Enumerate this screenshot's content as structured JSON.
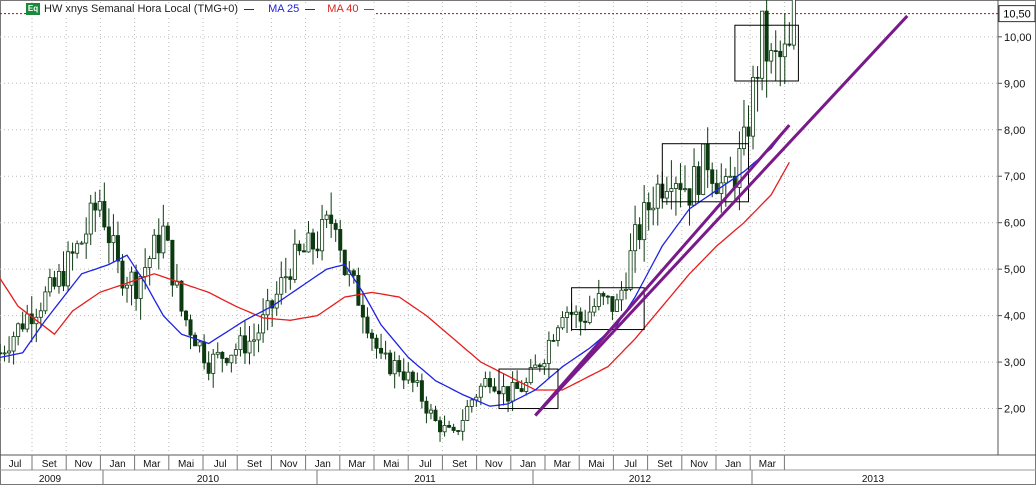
{
  "legend": {
    "badge": "Eq",
    "title": "HW xnys Semanal Hora Local (TMG+0)",
    "ma25": "MA 25",
    "ma40": "MA 40"
  },
  "colors": {
    "candle": "#0d3a10",
    "ma25": "#1e22e6",
    "ma40": "#e61e1e",
    "trendline": "#7a1a8a",
    "resistance": "#cc0000",
    "grid": "#bcbcbc",
    "price_tag_bg": "#ffffff"
  },
  "chart_data": {
    "type": "candlestick",
    "last_price_label": "10,50",
    "ylim": [
      1,
      10.75
    ],
    "yticks": [
      "2,00",
      "3,00",
      "4,00",
      "5,00",
      "6,00",
      "7,00",
      "8,00",
      "9,00",
      "10,00"
    ],
    "ytick_values": [
      2,
      3,
      4,
      5,
      6,
      7,
      8,
      9,
      10
    ],
    "month_ticks": [
      "Jul",
      "Set",
      "Nov",
      "Jan",
      "Mar",
      "Mai",
      "Jul",
      "Set",
      "Nov",
      "Jan",
      "Mar",
      "Mai",
      "Jul",
      "Set",
      "Nov",
      "Jan",
      "Mar",
      "Mai",
      "Jul",
      "Set",
      "Nov",
      "Jan",
      "Mar"
    ],
    "year_labels": [
      "2009",
      "2010",
      "2011",
      "2012",
      "2013"
    ],
    "price_path": [
      [
        0,
        3.2
      ],
      [
        6,
        4.0
      ],
      [
        12,
        4.6
      ],
      [
        18,
        5.6
      ],
      [
        22,
        6.5
      ],
      [
        26,
        5.0
      ],
      [
        30,
        4.7
      ],
      [
        36,
        5.8
      ],
      [
        40,
        4.1
      ],
      [
        46,
        3.0
      ],
      [
        52,
        3.3
      ],
      [
        56,
        3.5
      ],
      [
        60,
        4.2
      ],
      [
        64,
        5.1
      ],
      [
        70,
        5.6
      ],
      [
        74,
        6.2
      ],
      [
        76,
        5.0
      ],
      [
        80,
        4.2
      ],
      [
        84,
        3.0
      ],
      [
        88,
        2.9
      ],
      [
        92,
        2.4
      ],
      [
        96,
        1.7
      ],
      [
        100,
        1.4
      ],
      [
        104,
        2.2
      ],
      [
        108,
        2.7
      ],
      [
        112,
        2.3
      ],
      [
        116,
        2.5
      ],
      [
        120,
        3.2
      ],
      [
        124,
        4.2
      ],
      [
        128,
        3.9
      ],
      [
        132,
        4.3
      ],
      [
        136,
        4.2
      ],
      [
        140,
        5.6
      ],
      [
        144,
        6.6
      ],
      [
        148,
        7.2
      ],
      [
        152,
        6.7
      ],
      [
        156,
        7.4
      ],
      [
        160,
        6.6
      ],
      [
        164,
        7.6
      ],
      [
        168,
        10.0
      ],
      [
        170,
        9.4
      ],
      [
        174,
        9.6
      ],
      [
        175,
        10.5
      ]
    ],
    "ma25_path": [
      [
        0,
        3.1
      ],
      [
        5,
        3.2
      ],
      [
        10,
        3.9
      ],
      [
        14,
        4.4
      ],
      [
        18,
        4.9
      ],
      [
        24,
        5.1
      ],
      [
        28,
        5.3
      ],
      [
        32,
        4.7
      ],
      [
        36,
        4.0
      ],
      [
        40,
        3.6
      ],
      [
        46,
        3.4
      ],
      [
        54,
        3.9
      ],
      [
        60,
        4.2
      ],
      [
        66,
        4.6
      ],
      [
        72,
        5.0
      ],
      [
        76,
        5.1
      ],
      [
        80,
        4.5
      ],
      [
        84,
        3.8
      ],
      [
        90,
        3.1
      ],
      [
        96,
        2.6
      ],
      [
        102,
        2.3
      ],
      [
        108,
        2.05
      ],
      [
        112,
        2.1
      ],
      [
        118,
        2.4
      ],
      [
        124,
        2.9
      ],
      [
        130,
        3.3
      ],
      [
        136,
        3.8
      ],
      [
        140,
        4.4
      ],
      [
        146,
        5.5
      ],
      [
        152,
        6.3
      ],
      [
        158,
        6.7
      ],
      [
        164,
        7.1
      ],
      [
        170,
        7.6
      ],
      [
        174,
        8.1
      ]
    ],
    "ma40_path": [
      [
        0,
        4.8
      ],
      [
        4,
        4.2
      ],
      [
        8,
        3.9
      ],
      [
        12,
        3.6
      ],
      [
        16,
        4.1
      ],
      [
        22,
        4.5
      ],
      [
        28,
        4.7
      ],
      [
        34,
        4.9
      ],
      [
        40,
        4.7
      ],
      [
        46,
        4.5
      ],
      [
        52,
        4.2
      ],
      [
        58,
        3.95
      ],
      [
        64,
        3.9
      ],
      [
        70,
        4.0
      ],
      [
        76,
        4.4
      ],
      [
        82,
        4.5
      ],
      [
        88,
        4.4
      ],
      [
        94,
        4.0
      ],
      [
        100,
        3.5
      ],
      [
        106,
        3.0
      ],
      [
        112,
        2.7
      ],
      [
        118,
        2.4
      ],
      [
        124,
        2.4
      ],
      [
        128,
        2.6
      ],
      [
        134,
        2.9
      ],
      [
        140,
        3.5
      ],
      [
        146,
        4.2
      ],
      [
        152,
        4.9
      ],
      [
        158,
        5.5
      ],
      [
        164,
        6.0
      ],
      [
        170,
        6.6
      ],
      [
        174,
        7.3
      ]
    ],
    "trendline": [
      [
        118,
        1.85
      ],
      [
        200,
        10.45
      ]
    ],
    "trendline2": [
      [
        118,
        1.85
      ],
      [
        174,
        8.1
      ]
    ],
    "resistance_level": 10.5,
    "boxes": [
      {
        "x0": 110,
        "x1": 123,
        "y0": 2.0,
        "y1": 2.85
      },
      {
        "x0": 126,
        "x1": 142,
        "y0": 3.7,
        "y1": 4.6
      },
      {
        "x0": 146,
        "x1": 165,
        "y0": 6.45,
        "y1": 7.7
      },
      {
        "x0": 162,
        "x1": 176,
        "y0": 9.05,
        "y1": 10.25
      }
    ],
    "xlim": [
      0,
      220
    ],
    "grid": true
  }
}
